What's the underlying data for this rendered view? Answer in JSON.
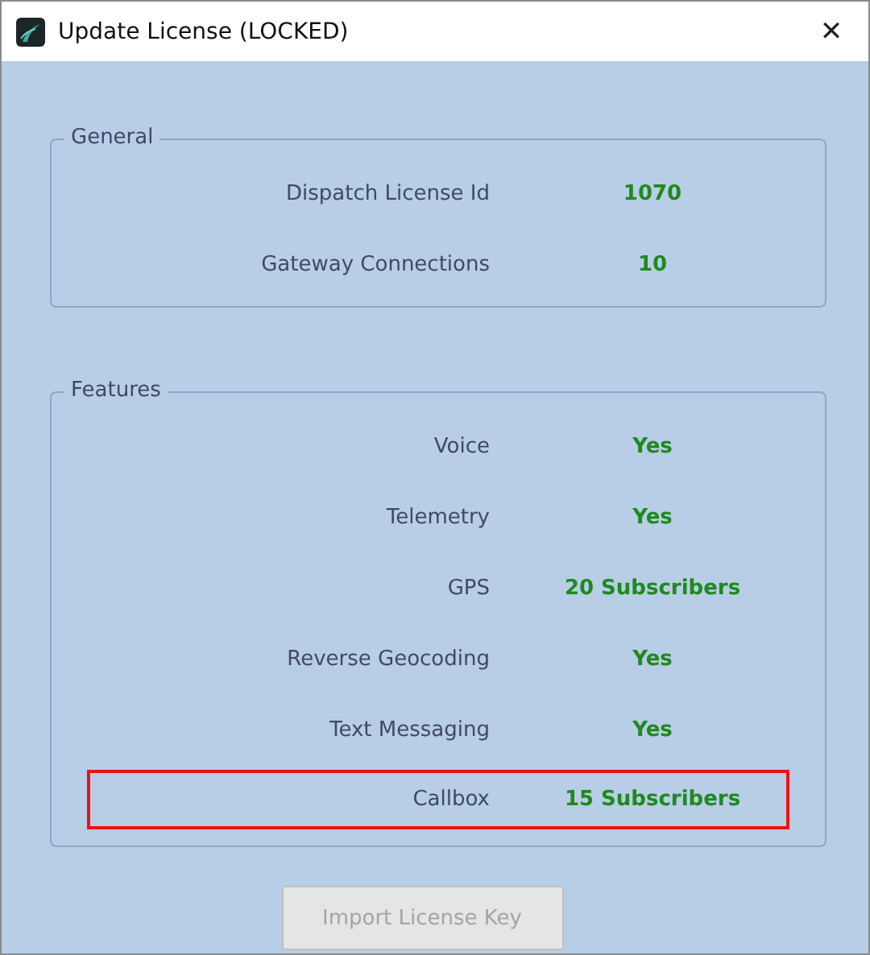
{
  "window": {
    "title": "Update License (LOCKED)",
    "close": "✕"
  },
  "groups": [
    {
      "title": "General",
      "rows": [
        {
          "label": "Dispatch License Id",
          "value": "1070",
          "highlighted": false
        },
        {
          "label": "Gateway Connections",
          "value": "10",
          "highlighted": false
        }
      ]
    },
    {
      "title": "Features",
      "rows": [
        {
          "label": "Voice",
          "value": "Yes",
          "highlighted": false
        },
        {
          "label": "Telemetry",
          "value": "Yes",
          "highlighted": false
        },
        {
          "label": "GPS",
          "value": "20 Subscribers",
          "highlighted": false
        },
        {
          "label": "Reverse Geocoding",
          "value": "Yes",
          "highlighted": false
        },
        {
          "label": "Text Messaging",
          "value": "Yes",
          "highlighted": false
        },
        {
          "label": "Callbox",
          "value": "15 Subscribers",
          "highlighted": true
        }
      ]
    }
  ],
  "button": {
    "label": "Import License Key",
    "disabled": true
  }
}
